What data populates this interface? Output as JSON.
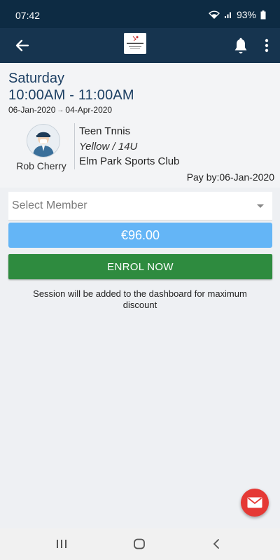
{
  "status_bar": {
    "time": "07:42",
    "battery": "93%"
  },
  "app_bar": {
    "back_icon": "arrow-left-icon",
    "logo_icon": "club-logo",
    "notifications_icon": "bell-icon",
    "menu_icon": "more-vertical-icon"
  },
  "session": {
    "day": "Saturday",
    "time_range": "10:00AM - 11:00AM",
    "start_date": "06-Jan-2020",
    "end_date": "04-Apr-2020",
    "date_arrow": "→",
    "coach_name": "Rob Cherry",
    "class_name": "Teen Tnnis",
    "level": "Yellow / 14U",
    "venue": "Elm Park Sports Club",
    "pay_by": "Pay by:06-Jan-2020"
  },
  "enrol": {
    "select_placeholder": "Select Member",
    "price": "€96.00",
    "enrol_label": "ENROL NOW",
    "note": "Session will be added to the dashboard for maximum discount"
  },
  "fab": {
    "icon": "mail-icon"
  },
  "colors": {
    "status_bar": "#0d2b43",
    "app_bar": "#16344f",
    "heading": "#1c3f63",
    "price_bar": "#64b5f6",
    "enrol_button": "#2e8b3f",
    "fab": "#e53935"
  }
}
